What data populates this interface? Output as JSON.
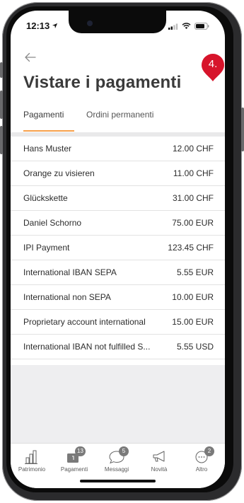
{
  "status_bar": {
    "time": "12:13",
    "location_icon": "location-arrow-icon",
    "signal_icon": "signal-icon",
    "wifi_icon": "wifi-icon",
    "battery_icon": "battery-icon"
  },
  "header": {
    "back_icon": "arrow-left-icon",
    "title": "Vistare i pagamenti",
    "step_badge": "4."
  },
  "tabs": [
    {
      "label": "Pagamenti",
      "active": true
    },
    {
      "label": "Ordini permanenti",
      "active": false
    }
  ],
  "payments": [
    {
      "name": "Hans Muster",
      "amount": "12.00 CHF"
    },
    {
      "name": "Orange zu visieren",
      "amount": "11.00 CHF"
    },
    {
      "name": "Glückskette",
      "amount": "31.00 CHF"
    },
    {
      "name": "Daniel Schorno",
      "amount": "75.00 EUR"
    },
    {
      "name": "IPI Payment",
      "amount": "123.45 CHF"
    },
    {
      "name": "International IBAN SEPA",
      "amount": "5.55 EUR"
    },
    {
      "name": "International non SEPA",
      "amount": "10.00 EUR"
    },
    {
      "name": "Proprietary account international",
      "amount": "15.00 EUR"
    },
    {
      "name": "International IBAN not fulfilled S...",
      "amount": "5.55 USD"
    }
  ],
  "tab_bar": [
    {
      "label": "Patrimonio",
      "icon": "bar-chart-icon",
      "badge": ""
    },
    {
      "label": "Pagamenti",
      "icon": "payments-icon",
      "badge": "13"
    },
    {
      "label": "Messaggi",
      "icon": "chat-bubble-icon",
      "badge": "5"
    },
    {
      "label": "Novità",
      "icon": "megaphone-icon",
      "badge": ""
    },
    {
      "label": "Altro",
      "icon": "more-icon",
      "badge": "2"
    }
  ],
  "colors": {
    "accent_orange": "#f7a14b",
    "badge_red": "#d7142b",
    "title_grey": "#3a3a3a",
    "badge_grey": "#7a7a7a"
  }
}
